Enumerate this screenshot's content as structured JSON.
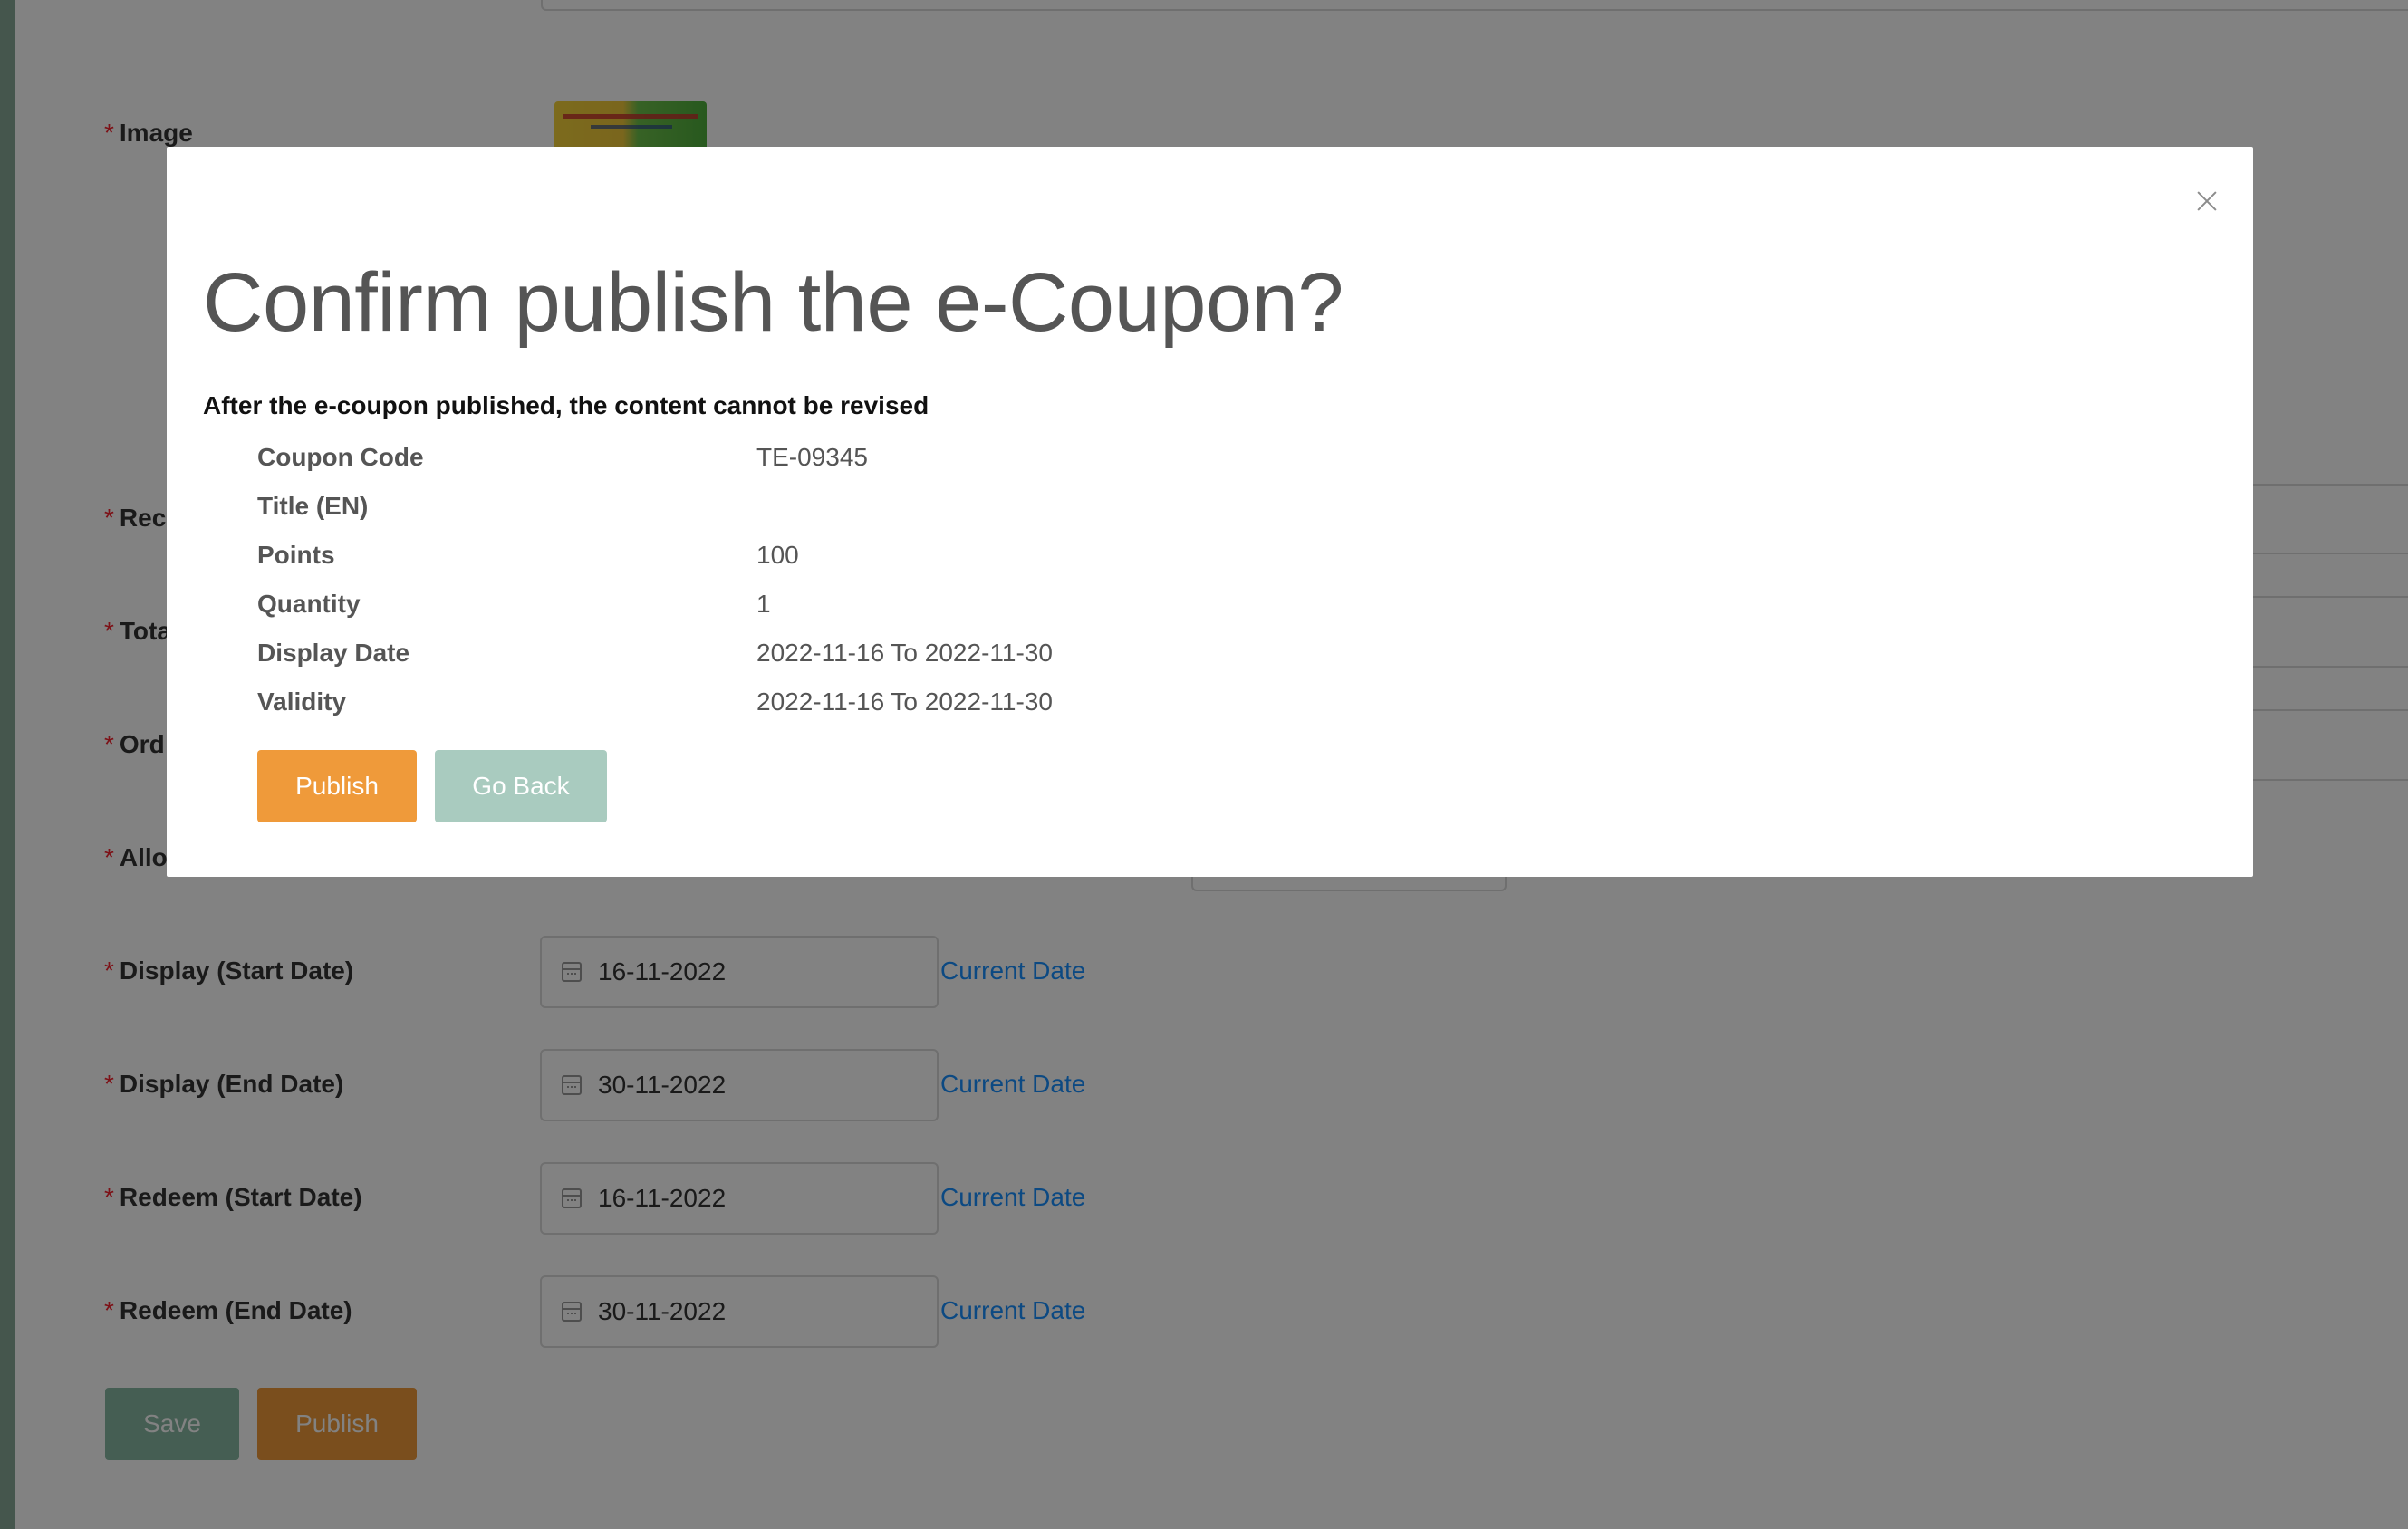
{
  "form": {
    "image_label": "Image",
    "partial_labels": [
      "Rec",
      "Tota",
      "Ord",
      "Allo"
    ],
    "display_start_label": "Display (Start Date)",
    "display_start_value": "16-11-2022",
    "display_end_label": "Display (End Date)",
    "display_end_value": "30-11-2022",
    "redeem_start_label": "Redeem (Start Date)",
    "redeem_start_value": "16-11-2022",
    "redeem_end_label": "Redeem (End Date)",
    "redeem_end_value": "30-11-2022",
    "current_date_link": "Current Date",
    "required_mark": "*",
    "save_button": "Save",
    "publish_button": "Publish"
  },
  "modal": {
    "title": "Confirm publish the e-Coupon?",
    "warning": "After the e-coupon published, the content cannot be revised",
    "details": [
      {
        "label": "Coupon Code",
        "value": "TE-09345"
      },
      {
        "label": "Title (EN)",
        "value": ""
      },
      {
        "label": "Points",
        "value": "100"
      },
      {
        "label": "Quantity",
        "value": "1"
      },
      {
        "label": "Display Date",
        "value": "2022-11-16 To 2022-11-30"
      },
      {
        "label": "Validity",
        "value": "2022-11-16 To 2022-11-30"
      }
    ],
    "publish_button": "Publish",
    "go_back_button": "Go Back"
  },
  "colors": {
    "publish_orange": "#ef9a3a",
    "go_back_green": "#a9cbbf",
    "save_green": "#87b8a4",
    "link_blue": "#1890ff",
    "required_red": "#f5222d"
  },
  "icons": {
    "close": "close-icon",
    "calendar": "calendar-icon"
  }
}
